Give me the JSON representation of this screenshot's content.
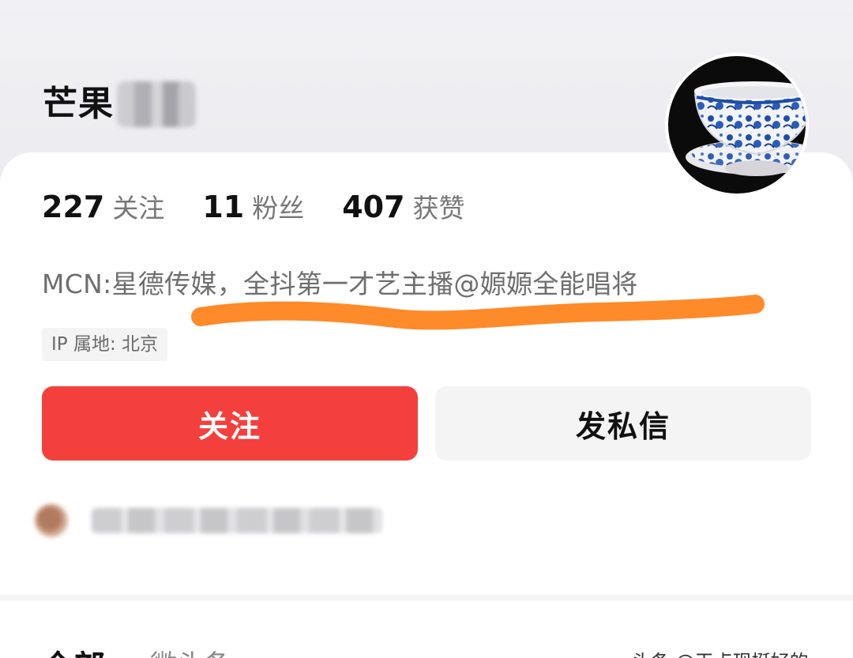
{
  "profile": {
    "username": "芒果",
    "avatar_desc": "blue-and-white-porcelain-cup"
  },
  "stats": [
    {
      "value": "227",
      "label": "关注"
    },
    {
      "value": "11",
      "label": "粉丝"
    },
    {
      "value": "407",
      "label": "获赞"
    }
  ],
  "bio": "MCN:星德传媒，全抖第一才艺主播@嫄嫄全能唱将",
  "ip_location": "IP 属地: 北京",
  "buttons": {
    "follow": "关注",
    "message": "发私信"
  },
  "tabs": {
    "all": "全部",
    "weitoutiao": "微头条"
  },
  "watermark": "头条 @干点现挺好的",
  "colors": {
    "accent_red": "#f4403d",
    "underline_orange": "#ff8a2a"
  }
}
